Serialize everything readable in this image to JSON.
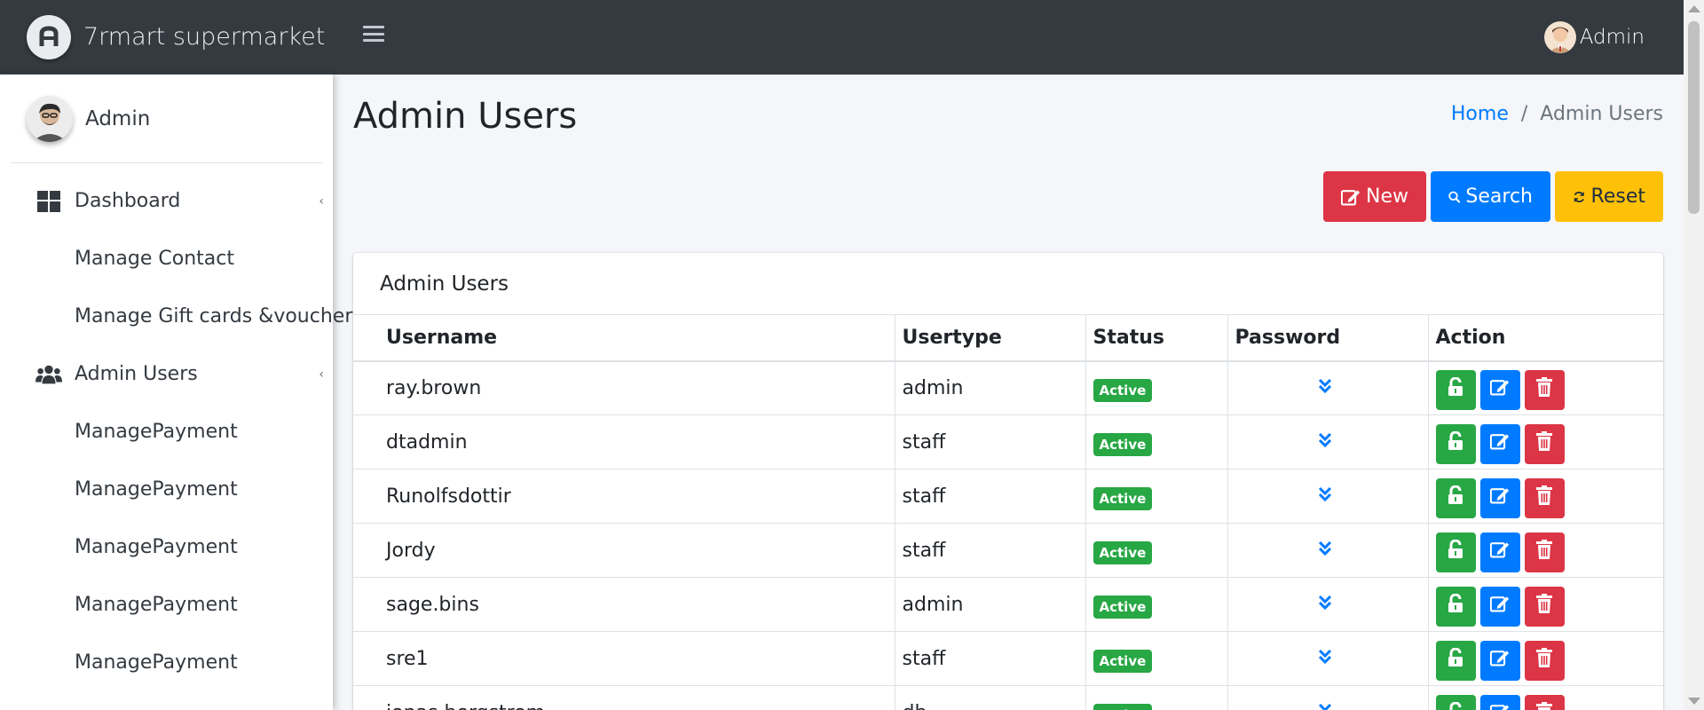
{
  "brand": {
    "name": "7rmart supermarket",
    "logo_icon": "logo-icon"
  },
  "topbar": {
    "user_name": "Admin"
  },
  "sidebar": {
    "user_name": "Admin",
    "items": [
      {
        "label": "Dashboard",
        "icon": "dashboard-icon",
        "has_caret": true
      },
      {
        "label": "Manage Contact"
      },
      {
        "label": "Manage Gift cards &voucher"
      },
      {
        "label": "Admin Users",
        "icon": "users-icon",
        "has_caret": true
      },
      {
        "label": "ManagePayment"
      },
      {
        "label": "ManagePayment"
      },
      {
        "label": "ManagePayment"
      },
      {
        "label": "ManagePayment"
      },
      {
        "label": "ManagePayment"
      }
    ]
  },
  "page": {
    "title": "Admin Users"
  },
  "breadcrumb": {
    "home": "Home",
    "separator": "/",
    "current": "Admin Users"
  },
  "toolbar": {
    "new_label": "New",
    "search_label": "Search",
    "reset_label": "Reset"
  },
  "card": {
    "title": "Admin Users"
  },
  "table": {
    "headers": {
      "username": "Username",
      "usertype": "Usertype",
      "status": "Status",
      "password": "Password",
      "action": "Action"
    },
    "rows": [
      {
        "username": "ray.brown",
        "usertype": "admin",
        "status": "Active"
      },
      {
        "username": "dtadmin",
        "usertype": "staff",
        "status": "Active"
      },
      {
        "username": "Runolfsdottir",
        "usertype": "staff",
        "status": "Active"
      },
      {
        "username": "Jordy",
        "usertype": "staff",
        "status": "Active"
      },
      {
        "username": "sage.bins",
        "usertype": "admin",
        "status": "Active"
      },
      {
        "username": "sre1",
        "usertype": "staff",
        "status": "Active"
      },
      {
        "username": "jonas.bergstrom",
        "usertype": "db",
        "status": "Active"
      }
    ]
  },
  "colors": {
    "topbar": "#343a40",
    "primary": "#007bff",
    "success": "#28a745",
    "danger": "#dc3545",
    "warning": "#ffc107"
  }
}
